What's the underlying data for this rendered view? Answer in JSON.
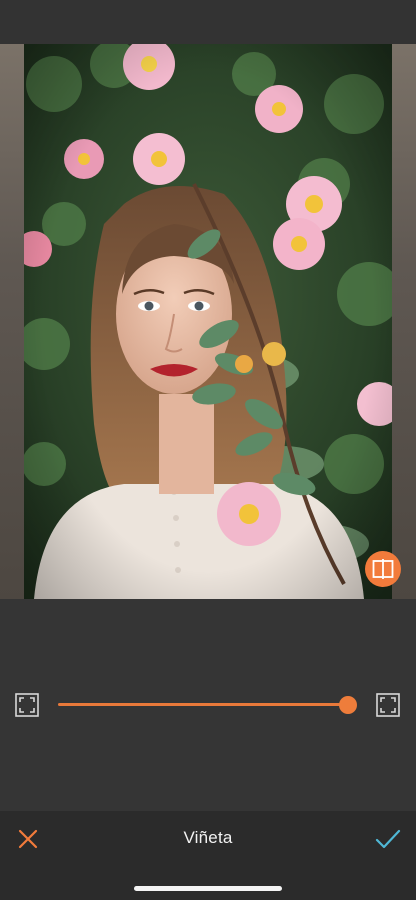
{
  "editor": {
    "tool_title": "Viñeta",
    "slider": {
      "value": 1.0
    },
    "accent_color": "#f27b3b",
    "confirm_color": "#4fb8d6"
  },
  "photo": {
    "content": "woman-with-pink-wild-roses"
  },
  "icons": {
    "compare": "split-compare-icon",
    "vignette_min": "vignette-frame-icon",
    "vignette_max": "vignette-frame-icon",
    "cancel": "close-icon",
    "confirm": "checkmark-icon"
  }
}
